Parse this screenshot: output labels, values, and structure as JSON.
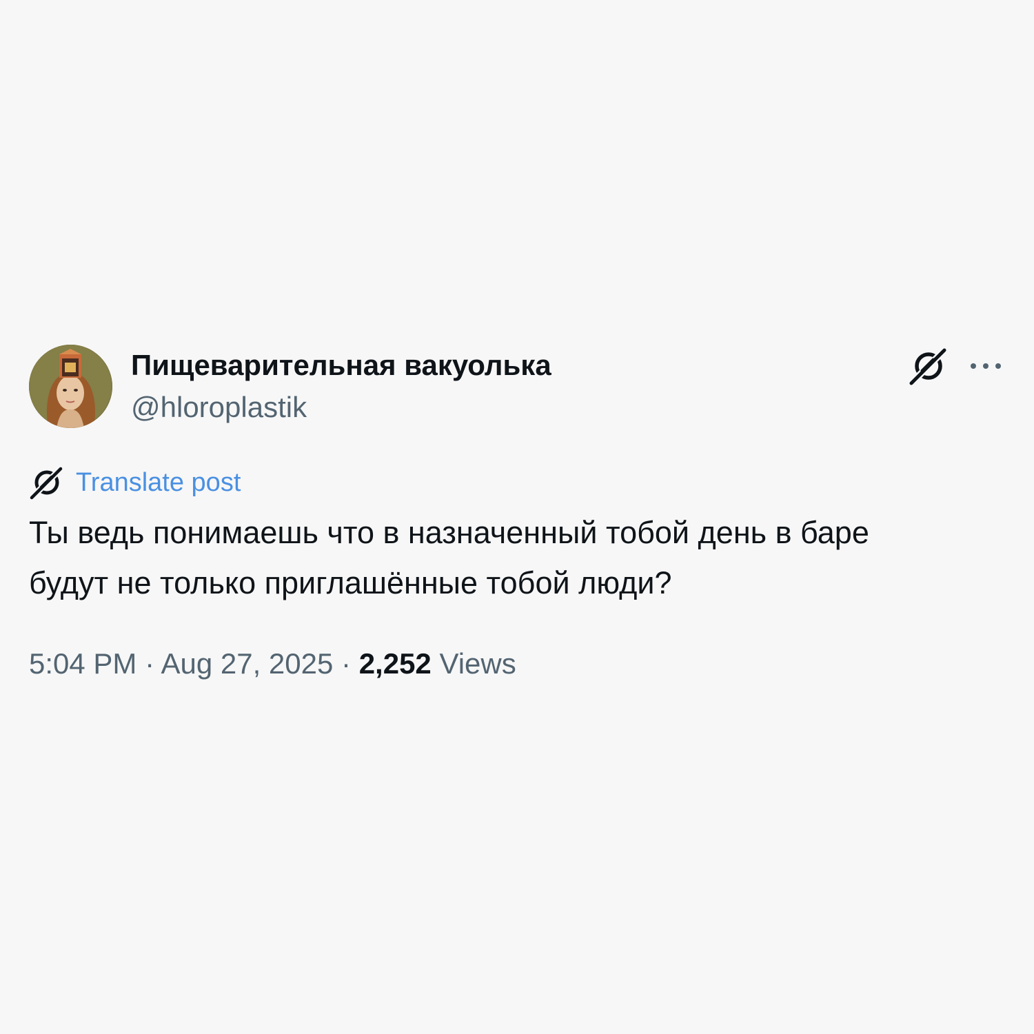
{
  "author": {
    "display_name": "Пищеварительная вакуолька",
    "handle": "@hloroplastik",
    "avatar_icon": "portrait-avatar"
  },
  "actions": {
    "grok_icon": "grok-icon",
    "more_icon": "more-horizontal-icon"
  },
  "translate": {
    "icon": "translate-icon",
    "label": "Translate post"
  },
  "post": {
    "lines": [
      "Ты ведь понимаешь что в назначенный тобой день в баре",
      "будут не только приглашённые тобой люди?"
    ]
  },
  "meta": {
    "time": "5:04 PM",
    "separator": "·",
    "date": "Aug 27, 2025",
    "views_count": "2,252",
    "views_label": "Views"
  },
  "colors": {
    "background": "#f7f7f7",
    "text_primary": "#0f1419",
    "text_secondary": "#536471",
    "link": "#4a90e2"
  }
}
